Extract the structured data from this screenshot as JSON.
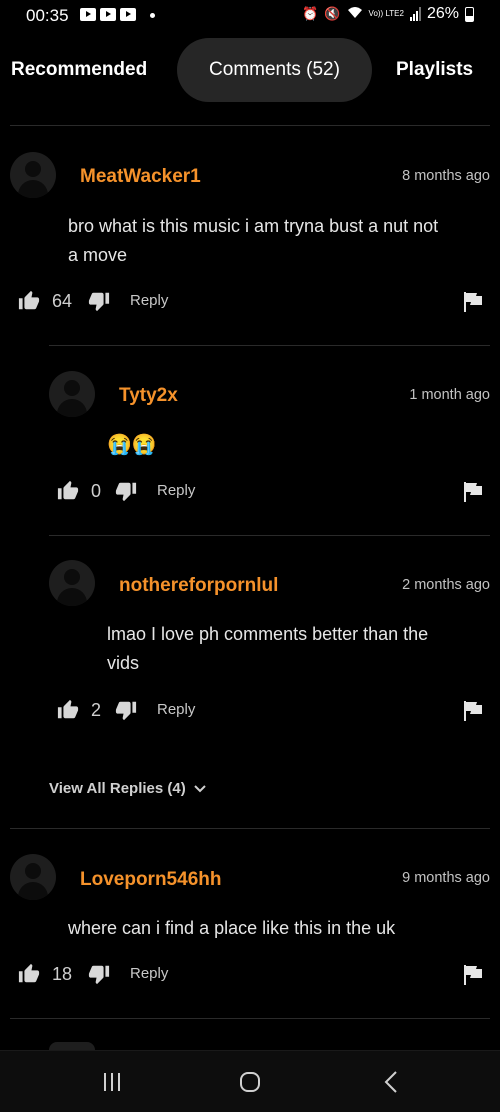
{
  "status_bar": {
    "time": "00:35",
    "network": "Vo)) LTE2",
    "battery": "26%"
  },
  "tabs": [
    {
      "label": "Recommended",
      "active": false
    },
    {
      "label": "Comments (52)",
      "active": true
    },
    {
      "label": "Playlists",
      "active": false
    }
  ],
  "comments": [
    {
      "username": "MeatWacker1",
      "time": "8 months ago",
      "text_line1": "bro what is this music i am tryna bust a nut not",
      "text_line2": "a move",
      "likes": "64",
      "reply_label": "Reply"
    },
    {
      "username": "Tyty2x",
      "time": "1 month ago",
      "text": "😭😭",
      "likes": "0",
      "reply_label": "Reply"
    },
    {
      "username": "nothereforpornlul",
      "time": "2 months ago",
      "text_line1": "lmao I love ph comments better than the",
      "text_line2": "vids",
      "likes": "2",
      "reply_label": "Reply"
    },
    {
      "username": "Loveporn546hh",
      "time": "9 months ago",
      "text": "where can i find a place like this in the uk",
      "likes": "18",
      "reply_label": "Reply"
    }
  ],
  "view_replies": "View All Replies (4)",
  "colors": {
    "username": "#f5922b",
    "background": "#000000",
    "active_tab": "#262626"
  }
}
